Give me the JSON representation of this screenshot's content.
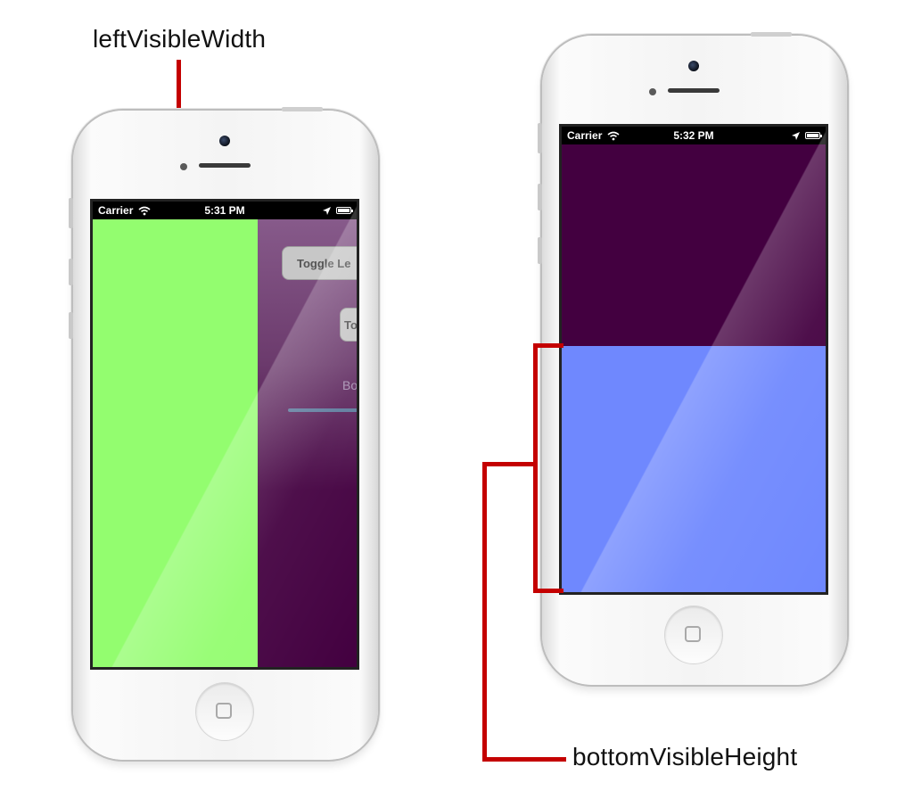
{
  "annotations": {
    "left_label": "leftVisibleWidth",
    "bottom_label": "bottomVisibleHeight",
    "bracket_color": "#c40000"
  },
  "phone_left": {
    "status_bar": {
      "carrier": "Carrier",
      "time": "5:31 PM"
    },
    "left_panel_color": "#93fd6f",
    "center_bg_top": "#8a5e8e",
    "center_bg_bottom": "#430040",
    "buttons": [
      "Toggle Le",
      "To"
    ],
    "label_text": "Bo"
  },
  "phone_right": {
    "status_bar": {
      "carrier": "Carrier",
      "time": "5:32 PM"
    },
    "top_bg_color": "#430040",
    "bottom_panel_color": "#6f88fe"
  }
}
